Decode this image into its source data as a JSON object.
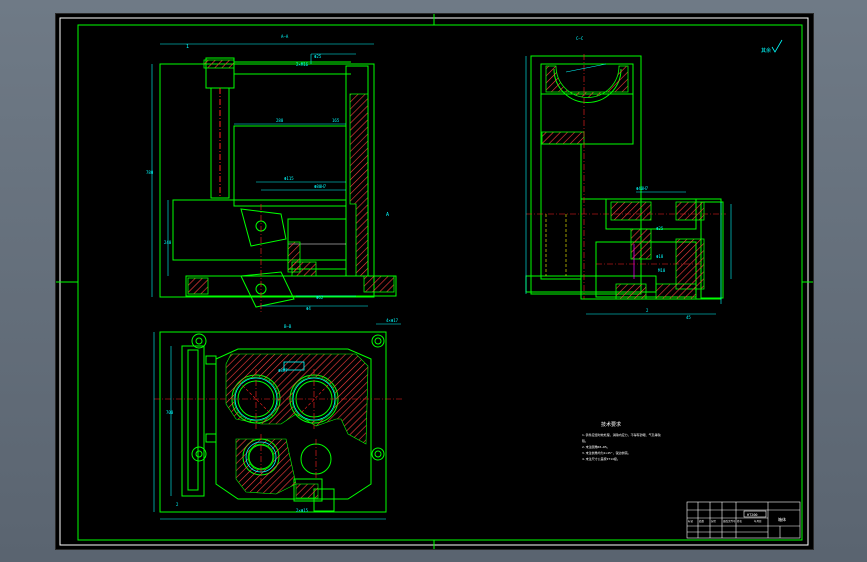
{
  "views": {
    "front_section": {
      "label": "A—A"
    },
    "side_section": {
      "label": "C—C"
    },
    "bottom_view": {
      "label": "B—B"
    },
    "side_mark": {
      "label": "A"
    }
  },
  "roughness": {
    "label": "其余"
  },
  "notes": {
    "title": "技术要求",
    "lines": [
      "1.铸件应经时效处理，消除内应力，不得有砂眼、气孔等缺",
      "陷。",
      "2.未注圆角R3~R5。",
      "3.未注倒角均为1×45°，锐边倒钝。",
      "4.未注尺寸公差按IT14级。"
    ]
  },
  "title_block": {
    "drawing_name": "箱体",
    "material": "HT200",
    "rows": [
      "标记",
      "处数",
      "分区",
      "更改文件号",
      "签名",
      "年月日"
    ]
  },
  "colors": {
    "frame": "#ffffff",
    "outline": "#00ff00",
    "dimension": "#00ffff",
    "hatch": "#ff4040",
    "centerline": "#ff2020",
    "magenta": "#ff00ff",
    "yellow": "#ffff00"
  }
}
